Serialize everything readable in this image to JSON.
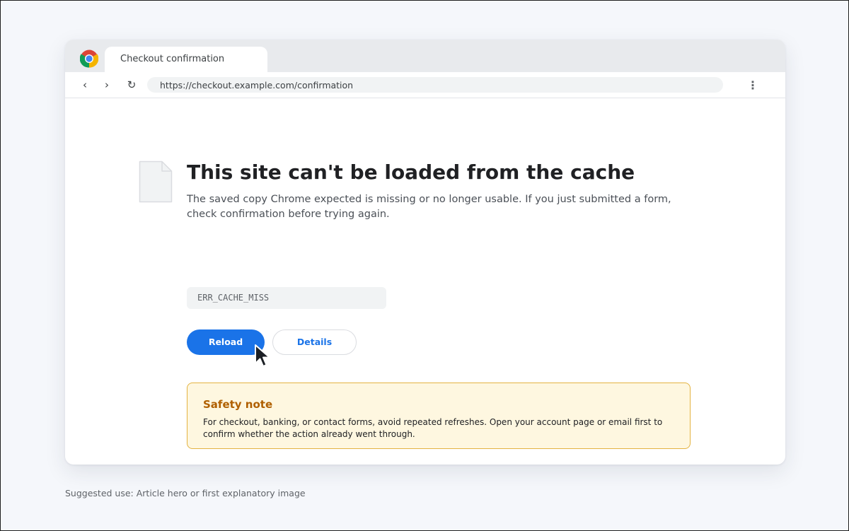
{
  "browser": {
    "tab": {
      "title": "Checkout confirmation"
    },
    "toolbar": {
      "back_glyph": "‹",
      "forward_glyph": "›",
      "reload_glyph": "↻",
      "url": "https://checkout.example.com/confirmation",
      "menu_glyph": "⋮"
    }
  },
  "error_page": {
    "icon": "document-icon",
    "title": "This site can't be loaded from the cache",
    "description": "The saved copy Chrome expected is missing or no longer usable. If you just submitted a form, check confirmation before trying again.",
    "error_code": "ERR_CACHE_MISS",
    "buttons": {
      "reload": "Reload",
      "details": "Details"
    },
    "safety_note": {
      "title": "Safety note",
      "body": "For checkout, banking, or contact forms, avoid repeated refreshes. Open your account page or email first to confirm whether the action already went through."
    }
  },
  "caption": "Suggested use: Article hero or first explanatory image",
  "colors": {
    "accent": "#1a73e8",
    "page_background": "#f5f7fb",
    "note_background": "#fef7e0",
    "note_border": "#e3b341",
    "note_title": "#b06000"
  }
}
